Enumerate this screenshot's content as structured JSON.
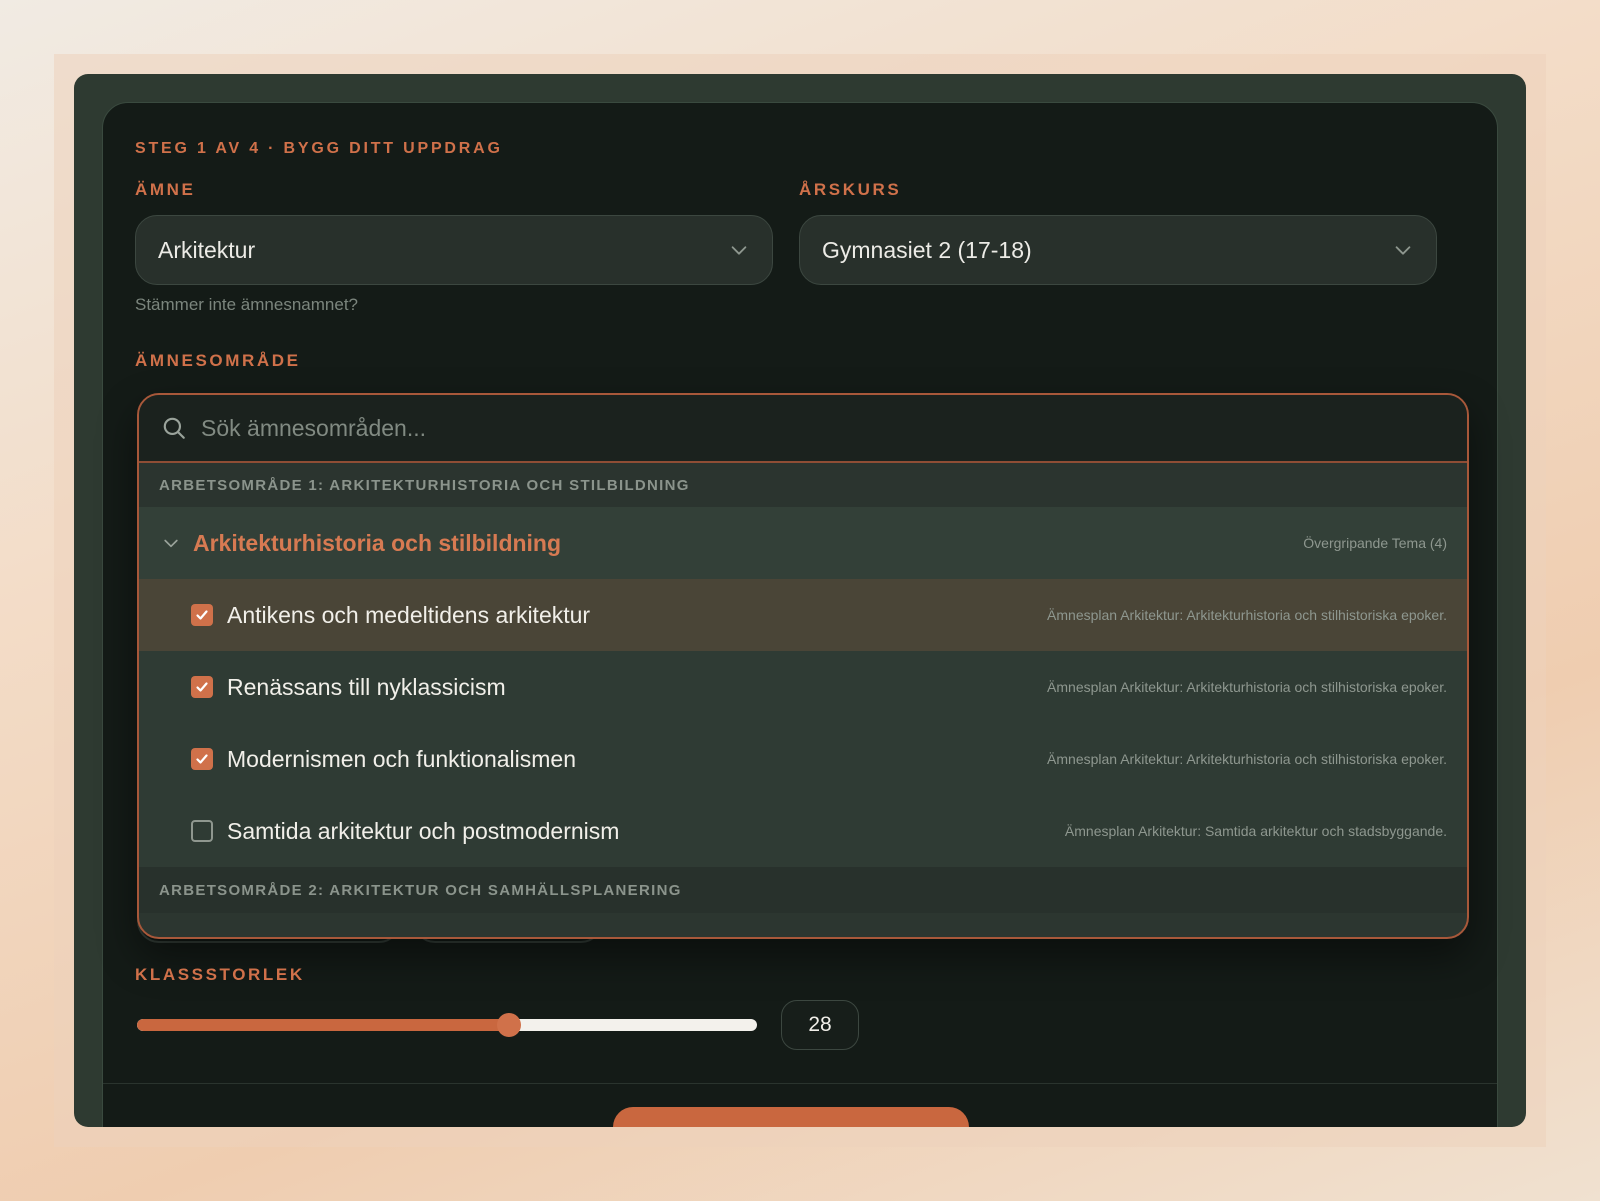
{
  "step_label": "STEG 1 AV 4 · BYGG DITT UPPDRAG",
  "subject": {
    "label": "ÄMNE",
    "value": "Arkitektur",
    "hint": "Stämmer inte ämnesnamnet?"
  },
  "grade": {
    "label": "ÅRSKURS",
    "value": "Gymnasiet 2 (17-18)"
  },
  "area": {
    "label": "ÄMNESOMRÅDE",
    "search_placeholder": "Sök ämnesområden...",
    "group1": {
      "header": "ARBETSOMRÅDE 1: ARKITEKTURHISTORIA OCH STILBILDNING",
      "theme": {
        "name": "Arkitekturhistoria och stilbildning",
        "meta": "Övergripande Tema (4)"
      },
      "items": [
        {
          "name": "Antikens och medeltidens arkitektur",
          "meta": "Ämnesplan Arkitektur: Arkitekturhistoria och stilhistoriska epoker.",
          "checked": true
        },
        {
          "name": "Renässans till nyklassicism",
          "meta": "Ämnesplan Arkitektur: Arkitekturhistoria och stilhistoriska epoker.",
          "checked": true
        },
        {
          "name": "Modernismen och funktionalismen",
          "meta": "Ämnesplan Arkitektur: Arkitekturhistoria och stilhistoriska epoker.",
          "checked": true
        },
        {
          "name": "Samtida arkitektur och postmodernism",
          "meta": "Ämnesplan Arkitektur: Samtida arkitektur och stadsbyggande.",
          "checked": false
        }
      ]
    },
    "group2": {
      "header": "ARBETSOMRÅDE 2: ARKITEKTUR OCH SAMHÄLLSPLANERING"
    }
  },
  "class_size": {
    "label": "KLASSSTORLEK",
    "value": "28",
    "fill_fraction": 0.6
  },
  "colors": {
    "accent": "#d0714a",
    "panel": "#141b17",
    "dropdown": "#2c3630"
  }
}
